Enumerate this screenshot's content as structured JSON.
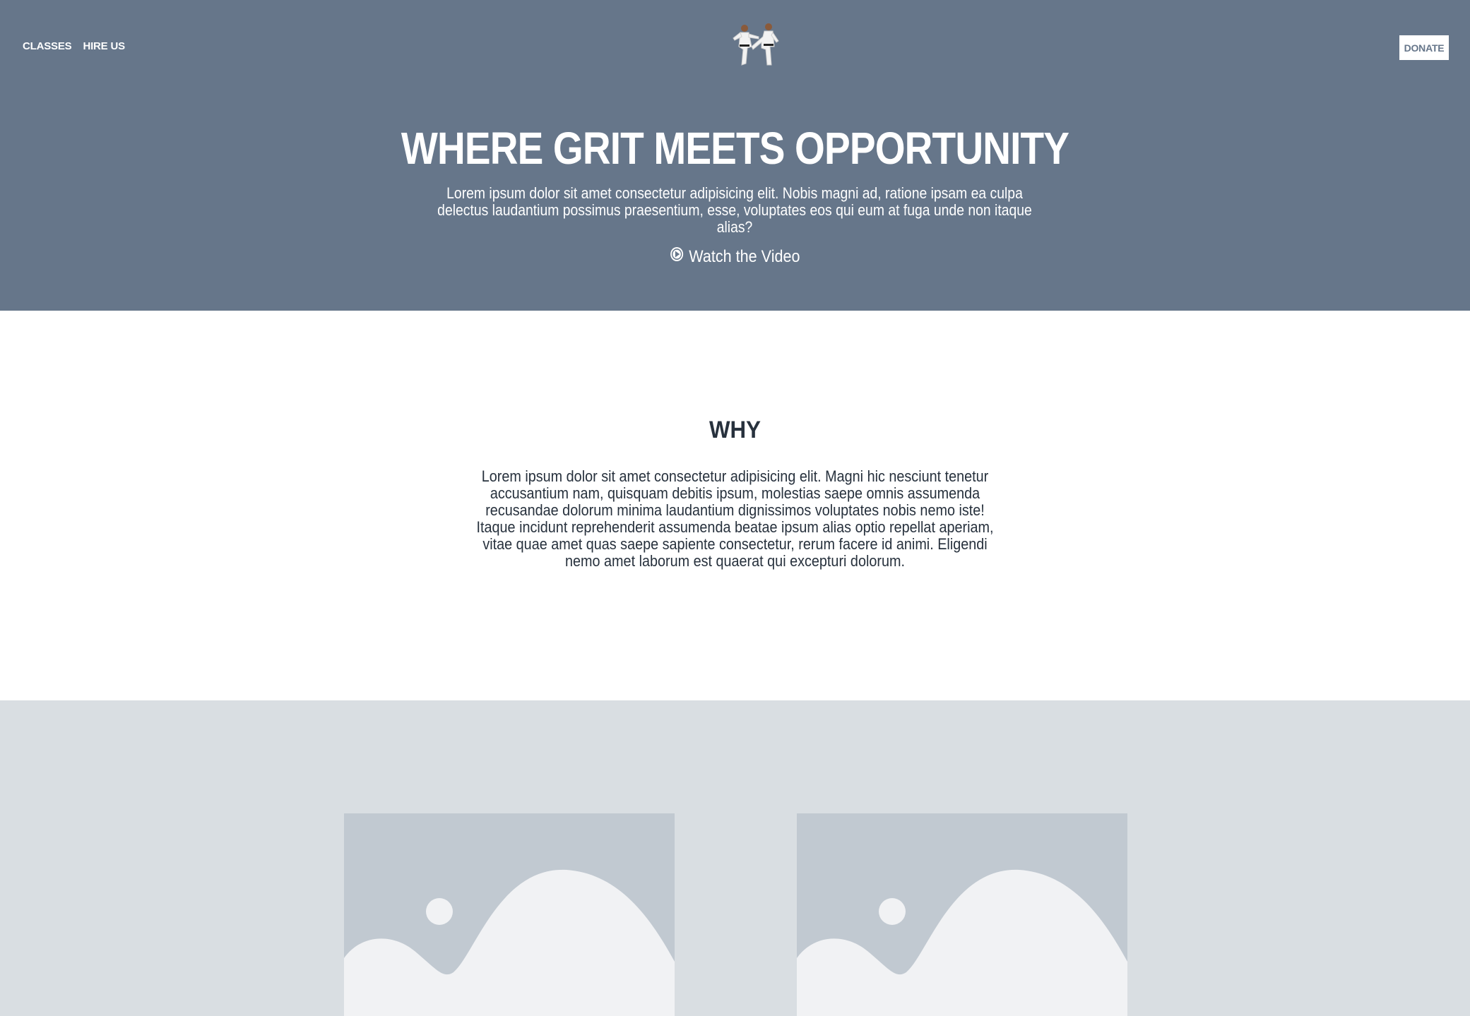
{
  "nav": {
    "links": [
      {
        "label": "CLASSES"
      },
      {
        "label": "HIRE US"
      }
    ],
    "donate_label": "DONATE"
  },
  "hero": {
    "title": "WHERE GRIT MEETS OPPORTUNITY",
    "subtitle": "Lorem ipsum dolor sit amet consectetur adipisicing elit. Nobis magni ad, ratione ipsam ea culpa delectus laudantium possimus praesentium, esse, voluptates eos qui eum at fuga unde non itaque alias?",
    "video_label": "Watch the Video",
    "video_icon": "play-circle-icon"
  },
  "why": {
    "title": "WHY",
    "text": "Lorem ipsum dolor sit amet consectetur adipisicing elit. Magni hic nesciunt tenetur accusantium nam, quisquam debitis ipsum, molestias saepe omnis assumenda recusandae dolorum minima laudantium dignissimos voluptates nobis nemo iste! Itaque incidunt reprehenderit assumenda beatae ipsum alias optio repellat aperiam, vitae quae amet quas saepe sapiente consectetur, rerum facere id animi. Eligendi nemo amet laborum est quaerat qui excepturi dolorum."
  },
  "gallery": {
    "items": [
      {
        "icon": "image-placeholder-icon"
      },
      {
        "icon": "image-placeholder-icon"
      }
    ]
  },
  "colors": {
    "hero_bg": "#66768a",
    "why_text": "#27313d",
    "gallery_bg": "#d9dee2",
    "placeholder_bg": "#c1c9d1",
    "placeholder_fg": "#f1f2f4"
  }
}
